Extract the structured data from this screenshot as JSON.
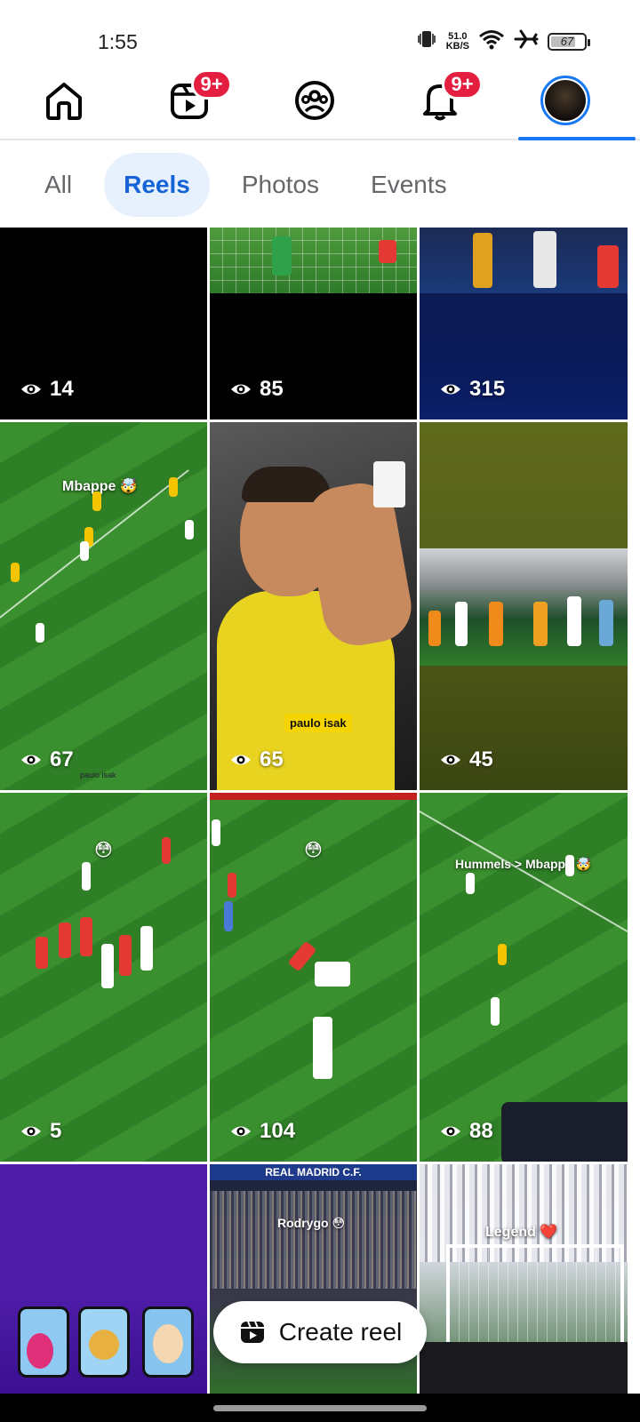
{
  "status": {
    "time": "1:55",
    "net_speed_value": "51.0",
    "net_speed_unit": "KB/S",
    "battery_level": "67"
  },
  "nav": {
    "items": [
      {
        "name": "home",
        "icon": "home-icon"
      },
      {
        "name": "reels",
        "icon": "reels-icon",
        "badge": "9+"
      },
      {
        "name": "groups",
        "icon": "groups-icon"
      },
      {
        "name": "notifications",
        "icon": "bell-icon",
        "badge": "9+"
      },
      {
        "name": "profile",
        "icon": "avatar",
        "active": true
      }
    ]
  },
  "filters": {
    "tabs": [
      {
        "label": "All",
        "active": false
      },
      {
        "label": "Reels",
        "active": true
      },
      {
        "label": "Photos",
        "active": false
      },
      {
        "label": "Events",
        "active": false
      }
    ]
  },
  "reels": [
    {
      "views": "14"
    },
    {
      "views": "85"
    },
    {
      "views": "315"
    },
    {
      "views": "67",
      "caption": "Mbappe 🤯",
      "watermark": "paulo isak"
    },
    {
      "views": "65",
      "caption": "paulo isak"
    },
    {
      "views": "45"
    },
    {
      "views": "5",
      "caption": "😳"
    },
    {
      "views": "104",
      "caption": "😳"
    },
    {
      "views": "88",
      "caption": "Hummels > Mbappe 🤯"
    },
    {
      "caption": ""
    },
    {
      "caption": "Rodrygo 😳",
      "banner": "REAL MADRID C.F."
    },
    {
      "caption": "Legend ❤️"
    }
  ],
  "create_reel": {
    "label": "Create reel"
  },
  "colors": {
    "accent": "#1877f2",
    "badge": "#e41e3f",
    "chip_active_bg": "#e7f0fd"
  }
}
